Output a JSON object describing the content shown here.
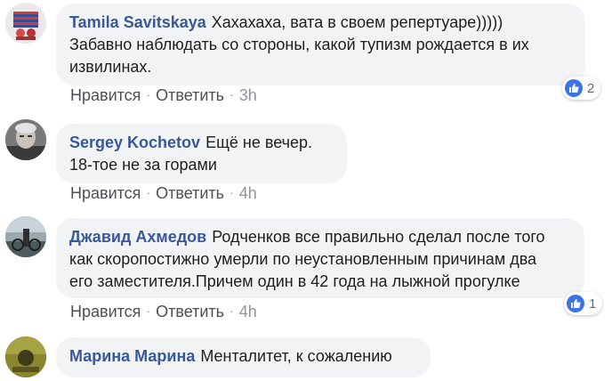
{
  "comments": [
    {
      "author": "Tamila Savitskaya",
      "lines": [
        "Хахахаха, вата в своем репертуаре)))))",
        "Забавно наблюдать со стороны, какой тупизм рождается в их",
        "извилинах."
      ],
      "like_label": "Нравится",
      "reply_label": "Ответить",
      "time": "3h",
      "reactions": "2"
    },
    {
      "author": "Sergey Kochetov",
      "lines": [
        "Ещё не вечер.",
        "18-тое не за горами"
      ],
      "like_label": "Нравится",
      "reply_label": "Ответить",
      "time": "4h"
    },
    {
      "author": "Джавид Ахмедов",
      "lines": [
        "Родченков все правильно сделал после того",
        "как скоропостижно умерли по неустановленным причинам два",
        "его заместителя.Причем один в 42 года на лыжной прогулке"
      ],
      "like_label": "Нравится",
      "reply_label": "Ответить",
      "time": "4h",
      "reactions": "1"
    },
    {
      "author": "Марина Марина",
      "lines": [
        "Менталитет, к сожалению"
      ]
    }
  ],
  "separator": "·",
  "colors": {
    "author": "#385898",
    "bubble": "#f2f3f5",
    "like_blue": "#3b74e8",
    "meta": "#90949c"
  },
  "icons": {
    "like": "thumbs-up-icon"
  }
}
